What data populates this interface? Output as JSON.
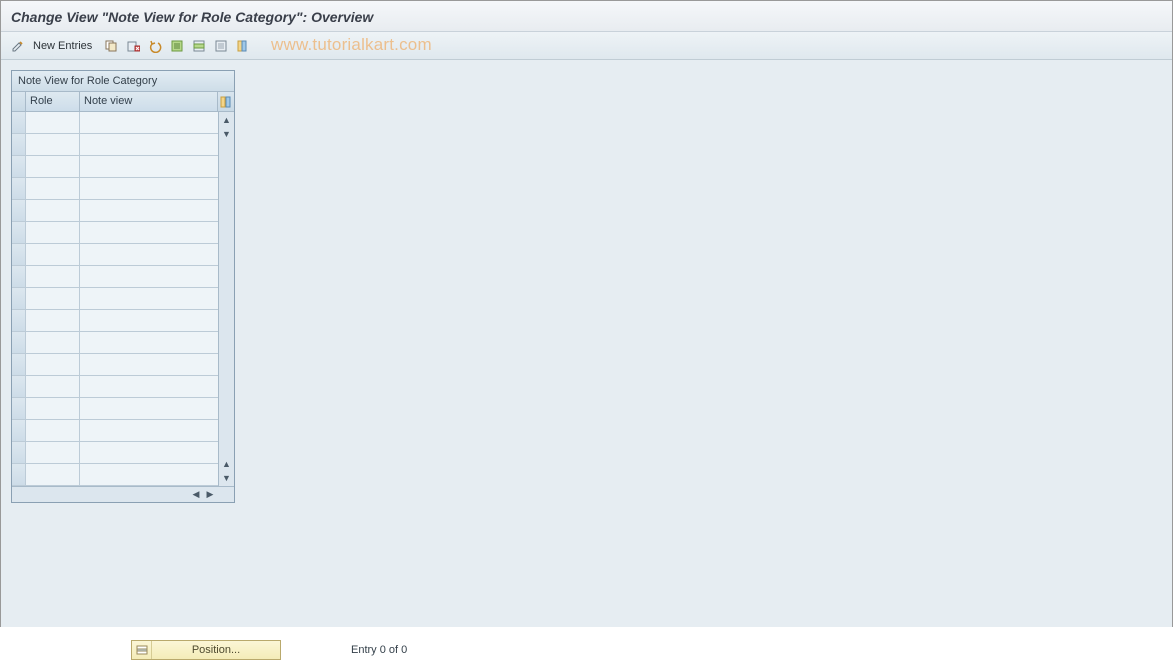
{
  "title": "Change View \"Note View for Role Category\": Overview",
  "toolbar": {
    "new_entries_label": "New Entries"
  },
  "watermark": "www.tutorialkart.com",
  "grid": {
    "title": "Note View for Role Category",
    "col1": "Role",
    "col2": "Note view",
    "row_count": 17
  },
  "footer": {
    "position_label": "Position...",
    "entry_text": "Entry 0 of 0"
  }
}
